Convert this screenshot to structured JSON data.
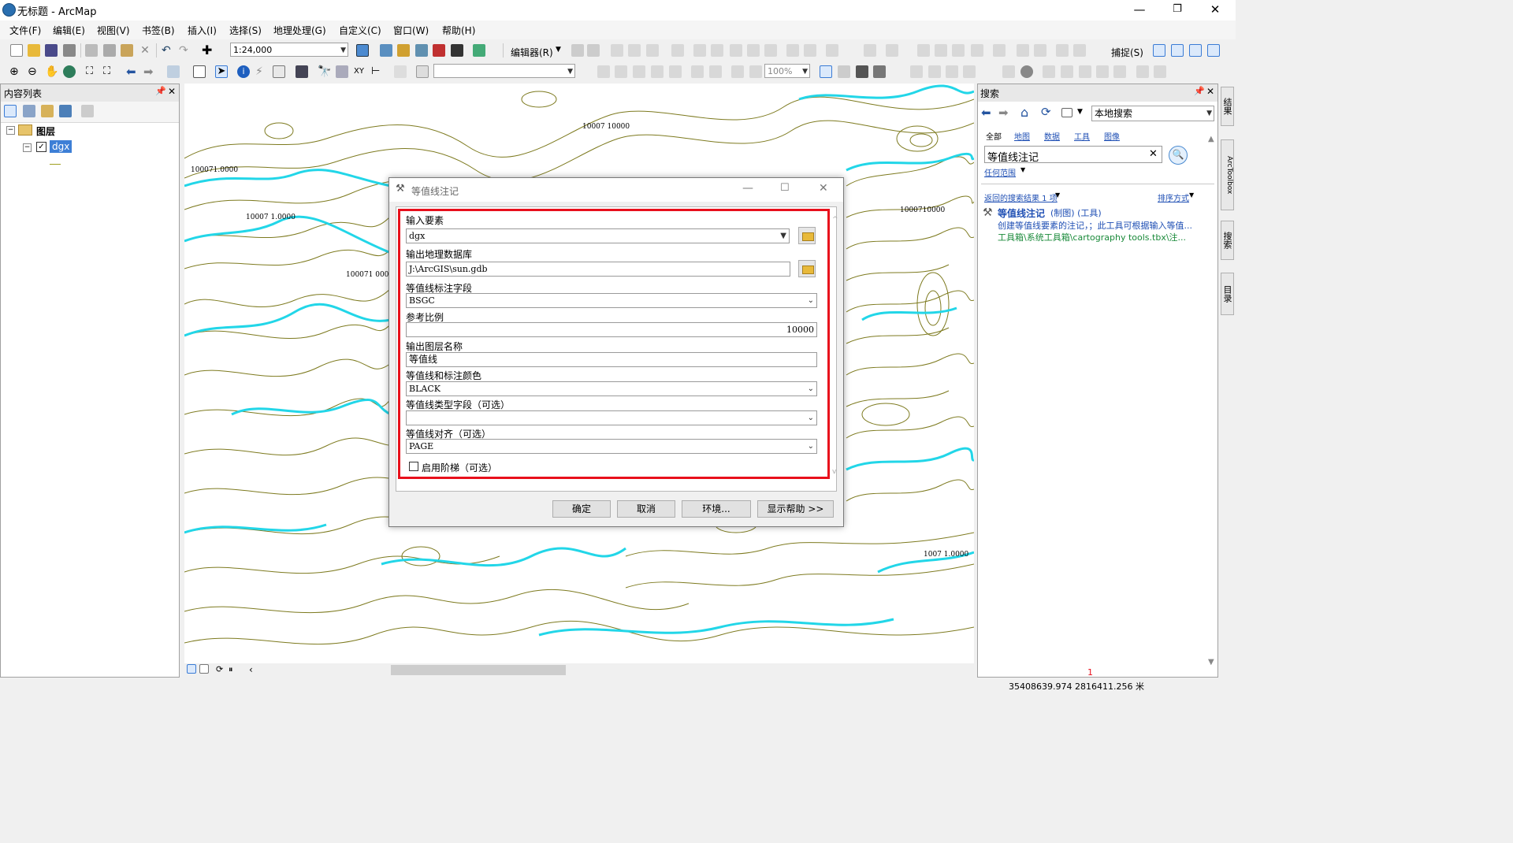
{
  "window": {
    "title": "无标题 - ArcMap",
    "min_icon": "minimize-icon",
    "max_icon": "restore-icon",
    "close_icon": "close-icon"
  },
  "menubar": [
    "文件(F)",
    "编辑(E)",
    "视图(V)",
    "书签(B)",
    "插入(I)",
    "选择(S)",
    "地理处理(G)",
    "自定义(C)",
    "窗口(W)",
    "帮助(H)"
  ],
  "toolbar": {
    "scale": "1:24,000",
    "editor_label": "编辑器(R)",
    "snapping_label": "捕捉(S)",
    "zoom_percent": "100%"
  },
  "toc": {
    "title": "内容列表",
    "group_label": "图层",
    "layer_name": "dgx",
    "layer_checked": true
  },
  "map": {
    "labels": [
      "100071.0000",
      "10007 1.0000",
      "100071 0000",
      "10007 10000",
      "10007 10000",
      "1000710000",
      "1007 1.0000"
    ]
  },
  "dialog": {
    "title": "等值线注记",
    "fields": [
      {
        "label": "输入要素",
        "value": "dgx"
      },
      {
        "label": "输出地理数据库",
        "value": "J:\\ArcGIS\\sun.gdb"
      },
      {
        "label": "等值线标注字段",
        "value": "BSGC"
      },
      {
        "label": "参考比例",
        "value": "10000"
      },
      {
        "label": "输出图层名称",
        "value": "等值线"
      },
      {
        "label": "等值线和标注颜色",
        "value": "BLACK"
      },
      {
        "label": "等值线类型字段（可选）",
        "value": ""
      },
      {
        "label": "等值线对齐（可选）",
        "value": "PAGE"
      }
    ],
    "checkbox_label": "启用阶梯（可选）",
    "checkbox_checked": false,
    "buttons": {
      "ok": "确定",
      "cancel": "取消",
      "env": "环境...",
      "help": "显示帮助 >>"
    }
  },
  "search": {
    "title": "搜索",
    "scope_select": "本地搜索",
    "tabs": [
      "全部",
      "地图",
      "数据",
      "工具",
      "图像"
    ],
    "query": "等值线注记",
    "scope_link": "任何范围",
    "result_count": "返回的搜索结果 1 项",
    "sort_label": "排序方式",
    "result": {
      "title": "等值线注记",
      "category": "(制图) (工具)",
      "desc": "创建等值线要素的注记，；此工具可根据输入等值...",
      "path": "工具箱\\系统工具箱\\cartography tools.tbx\\注..."
    }
  },
  "side_tabs": [
    "结果",
    "ArcToolbox",
    "搜索",
    "目录"
  ],
  "status": {
    "page_num": "1",
    "coords": "35408639.974  2816411.256 米"
  },
  "colors": {
    "contour": "#7d7a1f",
    "index_contour": "#22d6e8",
    "highlight": "#e8101c",
    "link": "#1f4fb4"
  }
}
